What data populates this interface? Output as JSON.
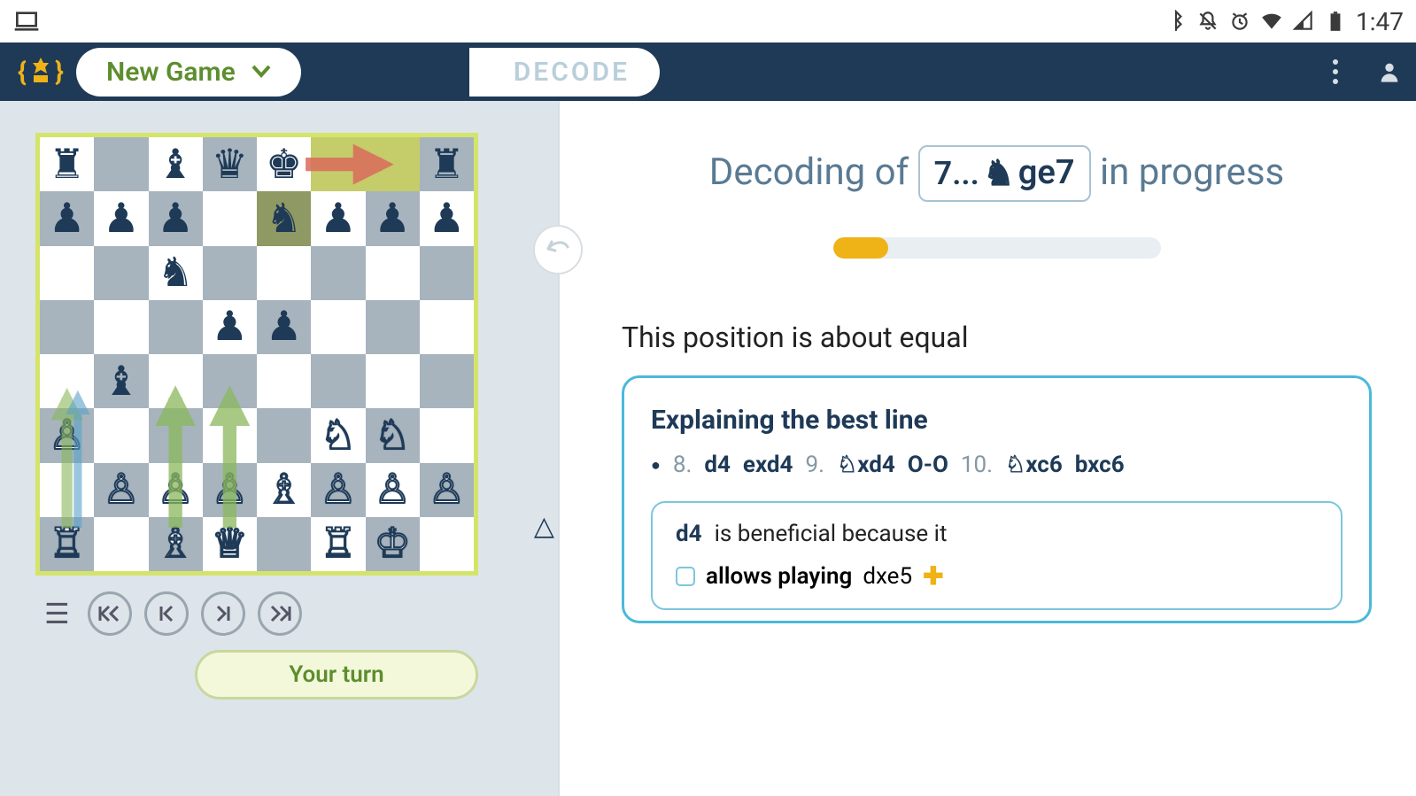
{
  "statusbar": {
    "time": "1:47"
  },
  "header": {
    "new_game": "New Game",
    "decode_tab": "DECODE"
  },
  "board": {
    "squares": [
      [
        "br",
        "",
        "bb",
        "bq",
        "bk",
        "",
        "",
        "br"
      ],
      [
        "bp",
        "bp",
        "bp",
        "",
        "bn",
        "bp",
        "bp",
        "bp"
      ],
      [
        "",
        "",
        "bn",
        "",
        "",
        "",
        "",
        ""
      ],
      [
        "",
        "",
        "",
        "bp",
        "bp",
        "",
        "",
        ""
      ],
      [
        "",
        "bb",
        "",
        "",
        "",
        "",
        "",
        ""
      ],
      [
        "wp",
        "",
        "",
        "",
        "",
        "wn",
        "wn",
        ""
      ],
      [
        "",
        "wp",
        "wp",
        "wp",
        "wb",
        "wp",
        "wp",
        "wp"
      ],
      [
        "wr",
        "",
        "wb",
        "wq",
        "",
        "wr",
        "wk",
        ""
      ]
    ],
    "highlights": [
      [
        0,
        5
      ],
      [
        0,
        6
      ]
    ],
    "darkHighlight": [
      1,
      4
    ],
    "turn_label": "Your turn"
  },
  "rightPanel": {
    "title_prefix": "Decoding of",
    "title_move": "7... ♞ge7",
    "title_suffix": "in progress",
    "progress_pct": 17,
    "eval": "This position is about equal",
    "best_line_title": "Explaining the best line",
    "line": [
      {
        "n": "8.",
        "m": "d4"
      },
      {
        "m": "exd4"
      },
      {
        "n": "9.",
        "m": "♘xd4"
      },
      {
        "m": "O-O"
      },
      {
        "n": "10.",
        "m": "♘xc6"
      },
      {
        "m": "bxc6"
      }
    ],
    "sub": {
      "move": "d4",
      "text": "is beneficial because it",
      "item": "allows playing",
      "item_move": "dxe5"
    }
  }
}
